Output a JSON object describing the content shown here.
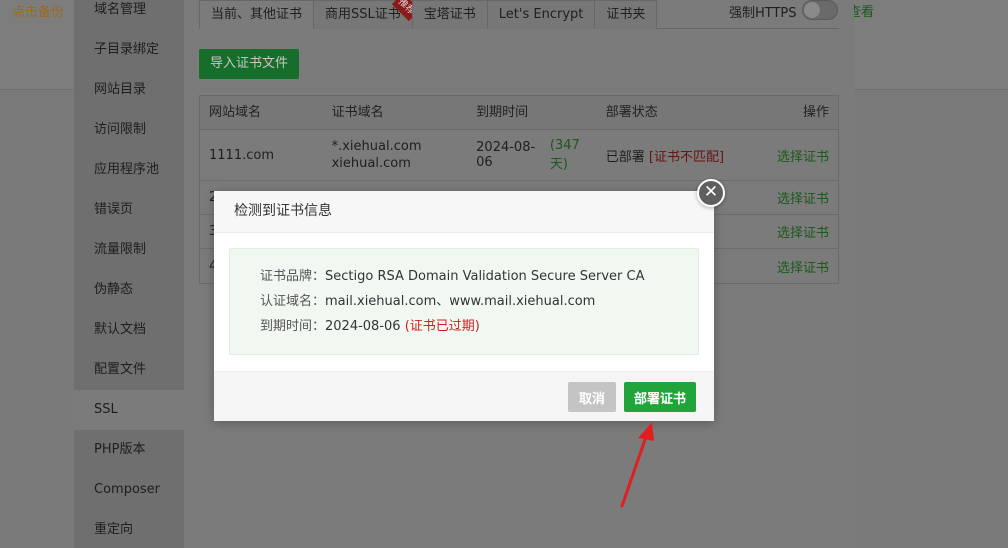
{
  "topbar": {
    "backup_label": "点击备份",
    "view_label": "查看"
  },
  "sidebar": {
    "items": [
      {
        "label": "域名管理"
      },
      {
        "label": "子目录绑定"
      },
      {
        "label": "网站目录"
      },
      {
        "label": "访问限制"
      },
      {
        "label": "应用程序池"
      },
      {
        "label": "错误页"
      },
      {
        "label": "流量限制"
      },
      {
        "label": "伪静态"
      },
      {
        "label": "默认文档"
      },
      {
        "label": "配置文件"
      },
      {
        "label": "SSL",
        "active": true
      },
      {
        "label": "PHP版本"
      },
      {
        "label": "Composer"
      },
      {
        "label": "重定向"
      }
    ]
  },
  "tabs": [
    {
      "label": "当前、其他证书",
      "active": true
    },
    {
      "label": "商用SSL证书",
      "ribbon": "推荐"
    },
    {
      "label": "宝塔证书"
    },
    {
      "label": "Let's Encrypt"
    },
    {
      "label": "证书夹"
    }
  ],
  "https_toggle": {
    "label": "强制HTTPS",
    "on": false
  },
  "import_button": "导入证书文件",
  "table": {
    "headers": [
      "网站域名",
      "证书域名",
      "到期时间",
      "部署状态",
      "操作"
    ],
    "rows": [
      {
        "site": "1111.com",
        "cert_domains": [
          "*.xiehual.com",
          "xiehual.com"
        ],
        "expire": "2024-08-06",
        "days": "(347天)",
        "status": "已部署",
        "status_note": "[证书不匹配]",
        "action": "选择证书"
      },
      {
        "site": "2",
        "cert_domains": [],
        "expire": "",
        "days": "",
        "status": "",
        "status_note": "",
        "action": "选择证书"
      },
      {
        "site": "3",
        "cert_domains": [],
        "expire": "",
        "days": "",
        "status": "",
        "status_note": "",
        "action": "选择证书"
      },
      {
        "site": "4",
        "cert_domains": [],
        "expire": "",
        "days": "",
        "status": "",
        "status_note": "",
        "action": "选择证书"
      }
    ]
  },
  "dialog": {
    "title": "检测到证书信息",
    "close_glyph": "✕",
    "brand_label": "证书品牌：",
    "brand_value": "Sectigo RSA Domain Validation Secure Server CA",
    "domain_label": "认证域名：",
    "domain_value": "mail.xiehual.com、www.mail.xiehual.com",
    "expire_label": "到期时间：",
    "expire_value": "2024-08-06",
    "expire_note": "(证书已过期)",
    "cancel_label": "取消",
    "deploy_label": "部署证书"
  },
  "colors": {
    "accent_green": "#20a53a",
    "expired_red": "#d01f1f",
    "annotation_arrow": "#e02020"
  },
  "icons": {
    "close": "close-icon",
    "annotation": "arrow-annotation-icon"
  }
}
